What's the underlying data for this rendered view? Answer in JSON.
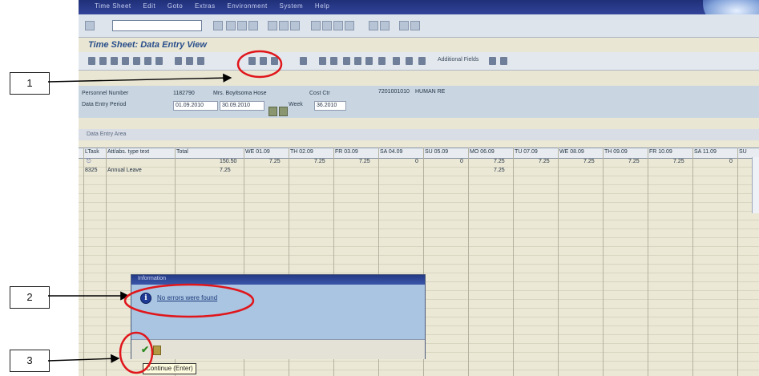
{
  "window": {
    "menu_items": [
      "Time Sheet",
      "Edit",
      "Goto",
      "Extras",
      "Environment",
      "System",
      "Help"
    ]
  },
  "app": {
    "title": "Time Sheet: Data Entry View",
    "additional_fields_label": "Additional Fields"
  },
  "header": {
    "personnel_number_label": "Personnel Number",
    "personnel_number": "1182790",
    "employee_name": "Mrs. Boyitsoma Hose",
    "cost_ctr_label": "Cost Ctr",
    "cost_ctr": "7201001010",
    "cost_ctr_name": "HUMAN RE",
    "data_entry_period_label": "Data Entry Period",
    "period_from": "01.09.2010",
    "period_to": "30.09.2010",
    "week_label": "Week",
    "week": "36.2010"
  },
  "tab": {
    "label": "Data Entry Area"
  },
  "table": {
    "columns": [
      "LTask",
      "Att/abs. type text",
      "Total",
      "WE 01.09",
      "TH 02.09",
      "FR 03.09",
      "SA 04.09",
      "SU 05.09",
      "MO 06.09",
      "TU 07.09",
      "WE 08.09",
      "TH 09.09",
      "FR 10.09",
      "SA 11.09",
      "SU"
    ],
    "rows": [
      [
        "",
        "",
        "150.50",
        "7.25",
        "7.25",
        "7.25",
        "0",
        "0",
        "7.25",
        "7.25",
        "7.25",
        "7.25",
        "7.25",
        "0",
        ""
      ],
      [
        "8325",
        "Annual Leave",
        "7.25",
        "",
        "",
        "",
        "",
        "",
        "7.25",
        "",
        "",
        "",
        "",
        "",
        ""
      ]
    ]
  },
  "dialog": {
    "title": "Information",
    "message": "No errors were found",
    "tooltip": "Continue (Enter)"
  },
  "callouts": [
    "1",
    "2",
    "3"
  ],
  "colors": {
    "highlight_circle": "#e0161b",
    "title_bar": "#26378a",
    "header_bg": "#c9d6e2"
  }
}
